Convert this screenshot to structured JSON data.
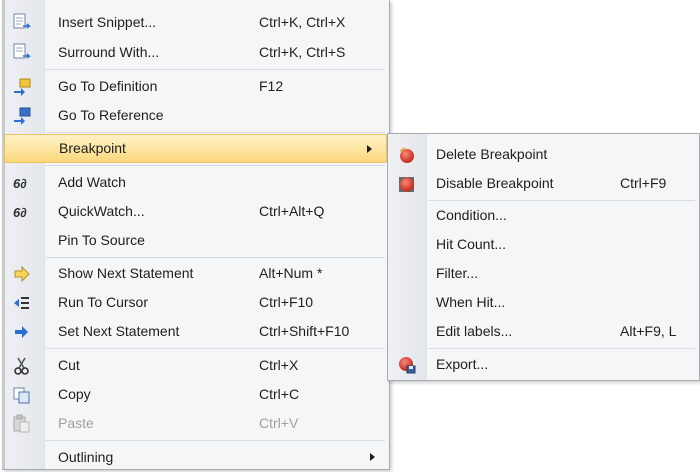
{
  "context_menu": {
    "items": [
      {
        "label": "Insert Snippet...",
        "shortcut": "Ctrl+K, Ctrl+X",
        "icon": "insert-snippet-icon"
      },
      {
        "label": "Surround With...",
        "shortcut": "Ctrl+K, Ctrl+S",
        "icon": "surround-with-icon"
      },
      {
        "label": "Go To Definition",
        "shortcut": "F12",
        "icon": "go-to-definition-icon"
      },
      {
        "label": "Go To Reference",
        "shortcut": "",
        "icon": "go-to-reference-icon"
      },
      {
        "label": "Breakpoint",
        "shortcut": "",
        "icon": "",
        "state": "highlighted",
        "has_submenu": true
      },
      {
        "label": "Add Watch",
        "shortcut": "",
        "icon": "watch-glasses-icon"
      },
      {
        "label": "QuickWatch...",
        "shortcut": "Ctrl+Alt+Q",
        "icon": "watch-glasses-icon"
      },
      {
        "label": "Pin To Source",
        "shortcut": "",
        "icon": ""
      },
      {
        "label": "Show Next Statement",
        "shortcut": "Alt+Num *",
        "icon": "show-next-statement-icon"
      },
      {
        "label": "Run To Cursor",
        "shortcut": "Ctrl+F10",
        "icon": "run-to-cursor-icon"
      },
      {
        "label": "Set Next Statement",
        "shortcut": "Ctrl+Shift+F10",
        "icon": "set-next-statement-icon"
      },
      {
        "label": "Cut",
        "shortcut": "Ctrl+X",
        "icon": "scissors-icon"
      },
      {
        "label": "Copy",
        "shortcut": "Ctrl+C",
        "icon": "copy-icon"
      },
      {
        "label": "Paste",
        "shortcut": "Ctrl+V",
        "icon": "paste-icon",
        "state": "disabled"
      },
      {
        "label": "Outlining",
        "shortcut": "",
        "icon": "",
        "has_submenu": true
      }
    ]
  },
  "breakpoint_submenu": {
    "items": [
      {
        "label": "Delete Breakpoint",
        "shortcut": "",
        "icon": "delete-breakpoint-icon"
      },
      {
        "label": "Disable Breakpoint",
        "shortcut": "Ctrl+F9",
        "icon": "disable-breakpoint-icon"
      },
      {
        "label": "Condition...",
        "shortcut": ""
      },
      {
        "label": "Hit Count...",
        "shortcut": ""
      },
      {
        "label": "Filter...",
        "shortcut": ""
      },
      {
        "label": "When Hit...",
        "shortcut": ""
      },
      {
        "label": "Edit labels...",
        "shortcut": "Alt+F9, L"
      },
      {
        "label": "Export...",
        "shortcut": "",
        "icon": "export-breakpoint-icon"
      }
    ]
  },
  "colors": {
    "menu_background": "#f5f6f8",
    "highlight": "#fbd87d",
    "disabled_text": "#a0a0a0",
    "breakpoint_red": "#d9352a"
  }
}
